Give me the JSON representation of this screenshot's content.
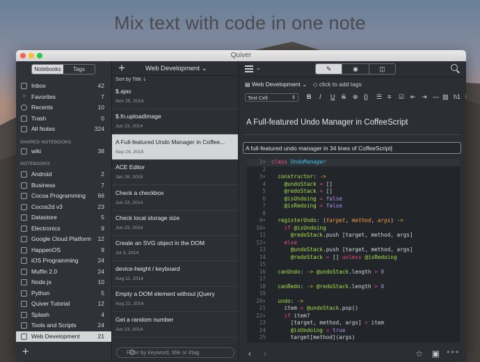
{
  "headline": "Mix text with code in one note",
  "window": {
    "title": "Quiver"
  },
  "sidebar": {
    "tabs": [
      "Notebooks",
      "Tags"
    ],
    "library": [
      {
        "label": "Inbox",
        "count": "42",
        "icon": "inbox-icon"
      },
      {
        "label": "Favorites",
        "count": "7",
        "icon": "star-icon"
      },
      {
        "label": "Recents",
        "count": "10",
        "icon": "clock-icon"
      },
      {
        "label": "Trash",
        "count": "0",
        "icon": "trash-icon"
      },
      {
        "label": "All Notes",
        "count": "324",
        "icon": "all-notes-icon"
      }
    ],
    "shared_header": "SHARED NOTEBOOKS",
    "shared": [
      {
        "label": "wiki",
        "count": "38"
      }
    ],
    "notebooks_header": "NOTEBOOKS",
    "notebooks": [
      {
        "label": "Android",
        "count": "2"
      },
      {
        "label": "Business",
        "count": "7"
      },
      {
        "label": "Cocoa Programming",
        "count": "66"
      },
      {
        "label": "Cocos2d v3",
        "count": "23"
      },
      {
        "label": "Datastore",
        "count": "5"
      },
      {
        "label": "Electronics",
        "count": "9"
      },
      {
        "label": "Google Cloud Platform",
        "count": "12"
      },
      {
        "label": "HappenOS",
        "count": "9"
      },
      {
        "label": "iOS Programming",
        "count": "24"
      },
      {
        "label": "Muffin 2.0",
        "count": "24"
      },
      {
        "label": "Node.js",
        "count": "10"
      },
      {
        "label": "Python",
        "count": "5"
      },
      {
        "label": "Quiver Tutorial",
        "count": "12"
      },
      {
        "label": "Splash",
        "count": "4"
      },
      {
        "label": "Tools and Scripts",
        "count": "24"
      },
      {
        "label": "Web Development",
        "count": "21"
      }
    ]
  },
  "notes_list": {
    "notebook_title": "Web Development",
    "sort_label": "Sort by Title ⇣",
    "notes": [
      {
        "title": "$.ajax",
        "date": "Nov 25, 2014"
      },
      {
        "title": "$.fn.uploadImage",
        "date": "Jun 23, 2014"
      },
      {
        "title": "A Full-featured Undo Manager in Coffee...",
        "date": "Sep 24, 2015"
      },
      {
        "title": "ACE Editor",
        "date": "Jan 28, 2015"
      },
      {
        "title": "Check a checkbox",
        "date": "Jun 23, 2014"
      },
      {
        "title": "Check local storage size",
        "date": "Jun 23, 2014"
      },
      {
        "title": "Create an SVG object in the DOM",
        "date": "Jul 3, 2014"
      },
      {
        "title": "device-height / keyboard",
        "date": "Aug 11, 2014"
      },
      {
        "title": "Empty a DOM element without jQuery",
        "date": "Aug 22, 2014"
      },
      {
        "title": "Get a random number",
        "date": "Jun 23, 2014"
      }
    ],
    "filter_placeholder": "Filter by keyword, title or #tag"
  },
  "editor": {
    "notebook": "Web Development",
    "tags_placeholder": "click to add tags",
    "cell_type": "Text Cell",
    "note_title": "A Full-featured Undo Manager in CoffeeScript",
    "text_cell": "A full-featured undo manager in 34 lines of CoffeeScript"
  }
}
